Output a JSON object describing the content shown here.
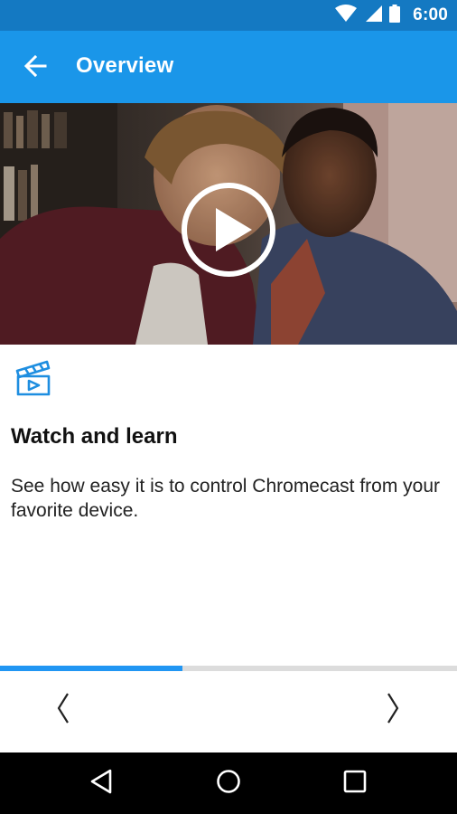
{
  "status_bar": {
    "time": "6:00",
    "icons": [
      "wifi-icon",
      "signal-icon",
      "battery-icon"
    ]
  },
  "app_bar": {
    "title": "Overview",
    "back_icon": "arrow-back-icon",
    "color": "#1a96e9",
    "status_color": "#1479c2"
  },
  "hero": {
    "play_icon": "play-circle-icon"
  },
  "content": {
    "icon": "clapperboard-play-icon",
    "heading": "Watch and learn",
    "body": "See how easy it is to control Chromecast from your favorite device."
  },
  "progress": {
    "fraction": 0.4,
    "color": "#2196f3"
  },
  "nav": {
    "prev_icon": "chevron-left-icon",
    "next_icon": "chevron-right-icon"
  },
  "system_nav": {
    "back": "triangle-back-icon",
    "home": "circle-home-icon",
    "recents": "square-recents-icon"
  }
}
